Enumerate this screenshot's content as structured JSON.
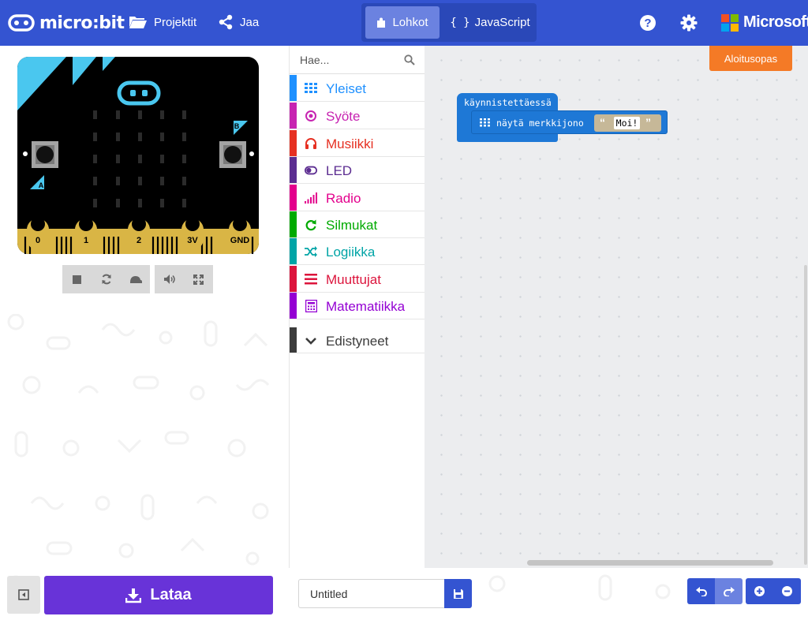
{
  "header": {
    "brand": "micro:bit",
    "projects_label": "Projektit",
    "share_label": "Jaa",
    "tabs": {
      "blocks": "Lohkot",
      "javascript": "JavaScript"
    },
    "help_icon": "help-icon",
    "settings_icon": "gear-icon",
    "company": "Microsoft"
  },
  "simulator": {
    "pin_labels": [
      "0",
      "1",
      "2",
      "3V",
      "GND"
    ],
    "button_a": "A",
    "button_b": "B",
    "controls": [
      "stop-icon",
      "restart-icon",
      "slow-motion-icon",
      "mute-icon",
      "fullscreen-icon"
    ]
  },
  "toolbox": {
    "search_placeholder": "Hae...",
    "categories": [
      {
        "label": "Yleiset",
        "color": "#1e90ff",
        "icon": "grid-icon"
      },
      {
        "label": "Syöte",
        "color": "#c724b1",
        "icon": "target-icon"
      },
      {
        "label": "Musiikki",
        "color": "#e63022",
        "icon": "headphones-icon"
      },
      {
        "label": "LED",
        "color": "#5c2d91",
        "icon": "toggle-icon"
      },
      {
        "label": "Radio",
        "color": "#e3008c",
        "icon": "signal-icon"
      },
      {
        "label": "Silmukat",
        "color": "#00aa00",
        "icon": "loop-icon"
      },
      {
        "label": "Logiikka",
        "color": "#00a4a6",
        "icon": "shuffle-icon"
      },
      {
        "label": "Muuttujat",
        "color": "#dc143c",
        "icon": "lines-icon"
      },
      {
        "label": "Matematiikka",
        "color": "#9400d3",
        "icon": "calculator-icon"
      }
    ],
    "advanced_label": "Edistyneet"
  },
  "workspace": {
    "tour_label": "Aloitusopas",
    "blocks": {
      "on_start_label": "käynnistettäessä",
      "show_string_label": "näytä merkkijono",
      "string_value": "Moi!"
    }
  },
  "bottombar": {
    "download_label": "Lataa",
    "project_name": "Untitled"
  },
  "colors": {
    "header": "#3454d1",
    "download": "#6833d8",
    "tour": "#f47a26",
    "block_basic": "#1e78d6"
  }
}
